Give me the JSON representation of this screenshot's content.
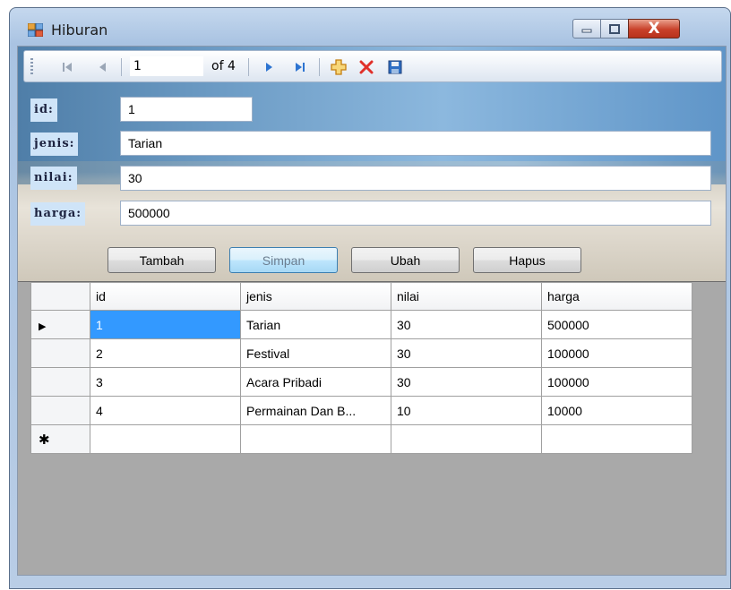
{
  "window": {
    "title": "Hiburan",
    "controls": {
      "minimize": "minimize",
      "maximize": "maximize",
      "close": "X"
    }
  },
  "navigator": {
    "position": "1",
    "count_label": "of 4",
    "icons": [
      "move-first-icon",
      "move-previous-icon",
      "move-next-icon",
      "move-last-icon",
      "add-new-icon",
      "delete-icon",
      "save-icon"
    ]
  },
  "form": {
    "fields": [
      {
        "label": "id:",
        "value": "1"
      },
      {
        "label": "jenis:",
        "value": "Tarian"
      },
      {
        "label": "nilai:",
        "value": "30"
      },
      {
        "label": "harga:",
        "value": "500000"
      }
    ],
    "buttons": [
      "Tambah",
      "Simpan",
      "Ubah",
      "Hapus"
    ]
  },
  "grid": {
    "columns": [
      "id",
      "jenis",
      "nilai",
      "harga"
    ],
    "rows": [
      [
        "1",
        "Tarian",
        "30",
        "500000"
      ],
      [
        "2",
        "Festival",
        "30",
        "100000"
      ],
      [
        "3",
        "Acara Pribadi",
        "30",
        "100000"
      ],
      [
        "4",
        "Permainan Dan B...",
        "10",
        "10000"
      ]
    ],
    "current_row_marker": "▶",
    "new_row_marker": "✱"
  },
  "colors": {
    "selection": "#3399ff",
    "grid_background": "#a9a9a9",
    "close_button": "#c8412a",
    "label_background": "#cfe4f8"
  }
}
